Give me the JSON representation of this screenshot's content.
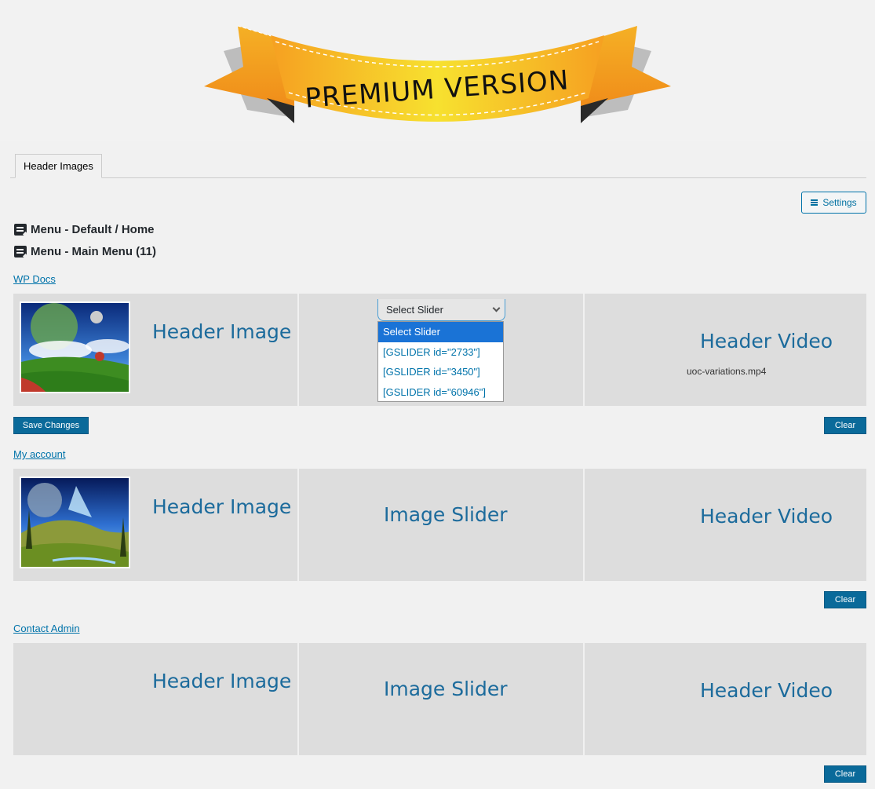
{
  "banner": {
    "text": "PREMIUM VERSION"
  },
  "tabs": [
    {
      "label": "Header Images"
    }
  ],
  "settings": {
    "label": "Settings",
    "icon": "hamburger-icon"
  },
  "menus": [
    {
      "title": "Menu - Default / Home"
    },
    {
      "title": "Menu - Main Menu (11)"
    }
  ],
  "sections": [
    {
      "link": "WP Docs",
      "header_image_label": "Header Image",
      "slider_select": {
        "selected": "Select Slider",
        "options": [
          "Select Slider",
          "[GSLIDER id=\"2733\"]",
          "[GSLIDER id=\"3450\"]",
          "[GSLIDER id=\"60946\"]"
        ]
      },
      "header_video_label": "Header Video",
      "video_file": "uoc-variations.mp4",
      "save_label": "Save Changes",
      "clear_label": "Clear"
    },
    {
      "link": "My account",
      "header_image_label": "Header Image",
      "image_slider_label": "Image Slider",
      "header_video_label": "Header Video",
      "clear_label": "Clear"
    },
    {
      "link": "Contact Admin",
      "header_image_label": "Header Image",
      "image_slider_label": "Image Slider",
      "header_video_label": "Header Video",
      "clear_label": "Clear"
    }
  ]
}
